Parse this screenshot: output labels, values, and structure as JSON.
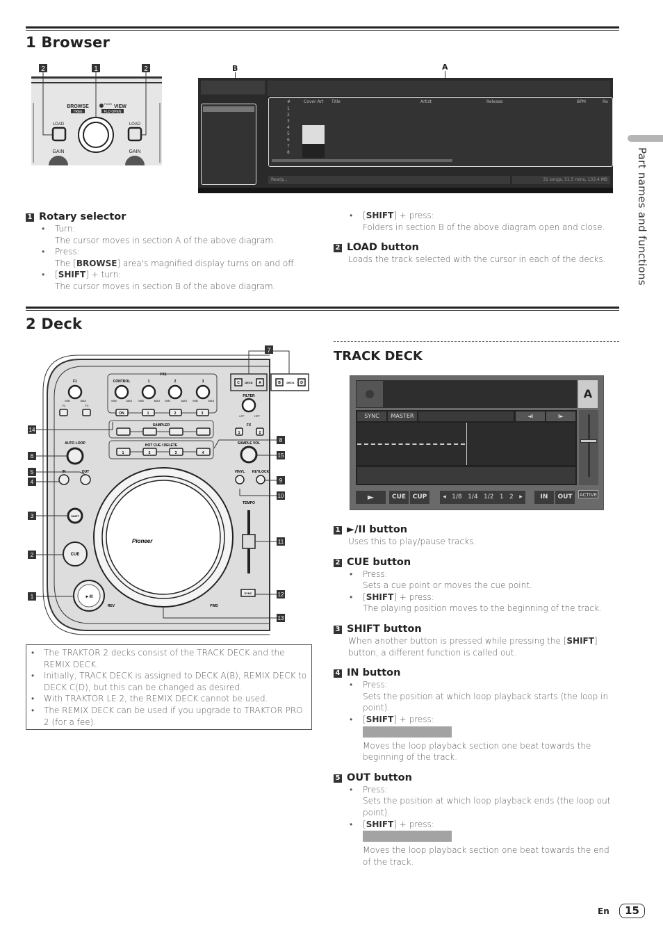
{
  "side_tab": {
    "label": "Part names and functions"
  },
  "browser_section": {
    "title": "1 Browser",
    "controller": {
      "callouts": [
        "2",
        "1",
        "2"
      ],
      "browse": "BROWSE",
      "tree": "TREE",
      "push": "PUSH",
      "view": "VIEW",
      "fld_open": "FLD OPEN",
      "load_left": "LOAD",
      "load_right": "LOAD",
      "gain_left": "GAIN",
      "gain_right": "GAIN"
    },
    "screen_labels": {
      "b": "B",
      "a": "A"
    },
    "screen": {
      "columns": [
        "#",
        "Cover Art",
        "Title",
        "Artist",
        "Release",
        "BPM",
        "Ra"
      ],
      "row_numbers": [
        "1",
        "2",
        "3",
        "4",
        "5",
        "6",
        "7",
        "8"
      ],
      "status_left": "Ready...",
      "status_right": "31 songs, 51.5 mins, 133.4 MB"
    },
    "rotary": {
      "num": "1",
      "title": "Rotary selector",
      "turn": "Turn:",
      "turn_desc": "The cursor moves in section A of the above diagram.",
      "press": "Press:",
      "press_pre": "The [",
      "press_bold": "BROWSE",
      "press_post": "] area's magnified display turns on and off.",
      "shift_pre": "[",
      "shift_bold": "SHIFT",
      "shift_turn_post": "] + turn:",
      "shift_turn_desc": "The cursor moves in section B of the above diagram.",
      "shift_press_post": "] + press:",
      "shift_press_desc": "Folders in section B of the above diagram open and close."
    },
    "load": {
      "num": "2",
      "title": "LOAD button",
      "desc": "Loads the track selected with the cursor in each of the decks."
    }
  },
  "deck_section": {
    "title": "2 Deck",
    "diagram": {
      "fx1": "FX1",
      "f1": "F1",
      "f2": "F2",
      "f3": "F3",
      "control": "CONTROL",
      "k1": "1",
      "k2": "2",
      "k3": "3",
      "min": "MIN",
      "max": "MAX",
      "on": "ON",
      "sampler": "SAMPLER",
      "hot_cue": "HOT CUE / DELETE",
      "auto_loop": "AUTO LOOP",
      "in": "IN",
      "out": "OUT",
      "filter": "FILTER",
      "lpf": "LPF",
      "hpf": "HPF",
      "fx": "FX",
      "sample_vol": "SAMPLE VOL",
      "vinyl": "VINYL",
      "keylock": "KEYLOCK",
      "tempo": "TEMPO",
      "sync": "SYNC",
      "rev": "REV",
      "fwd": "FWD",
      "cue": "CUE",
      "shift": "SHIFT",
      "deck": "DECK",
      "c": "C",
      "a": "A",
      "b": "B",
      "d": "D",
      "play": "►/II",
      "logo": "Pioneer",
      "callouts_left": [
        "14",
        "6",
        "5",
        "4",
        "3",
        "2",
        "1"
      ],
      "callouts_right": [
        "8",
        "15",
        "9",
        "10",
        "11",
        "12",
        "13"
      ],
      "callout_top": "7"
    },
    "notes": [
      "The TRAKTOR 2 decks consist of the TRACK DECK and the REMIX DECK.",
      "Initially, TRACK DECK is assigned to DECK A(B), REMIX DECK to DECK C(D), but this can be changed as desired.",
      "With TRAKTOR LE 2, the REMIX DECK cannot be used.",
      "The REMIX DECK can be used if you upgrade to TRAKTOR PRO 2 (for a fee)."
    ],
    "track_deck": {
      "title": "TRACK DECK",
      "screen": {
        "deck_letter": "A",
        "sync": "SYNC",
        "master": "MASTER",
        "cue": "CUE",
        "cup": "CUP",
        "loop_sizes": [
          "1/8",
          "1/4",
          "1/2",
          "1",
          "2"
        ],
        "in": "IN",
        "out": "OUT",
        "active": "ACTIVE"
      },
      "items": [
        {
          "num": "1",
          "title": "►/II button",
          "desc": "Uses this to play/pause tracks."
        },
        {
          "num": "2",
          "title": "CUE button",
          "press": "Press:",
          "press_desc": "Sets a cue point or moves the cue point.",
          "shift_pre": "[",
          "shift_bold": "SHIFT",
          "shift_post": "] + press:",
          "shift_desc": "The playing position moves to the beginning of the track."
        },
        {
          "num": "3",
          "title": "SHIFT button",
          "desc_pre": "When another button is pressed while pressing the [",
          "desc_bold": "SHIFT",
          "desc_post": "] button, a different function is called out."
        },
        {
          "num": "4",
          "title": "IN button",
          "press": "Press:",
          "press_desc": "Sets the position at which loop playback starts (the loop in point).",
          "shift_pre": "[",
          "shift_bold": "SHIFT",
          "shift_post": "] + press:",
          "shift_desc": "Moves the loop playback section one beat towards the beginning of the track."
        },
        {
          "num": "5",
          "title": "OUT button",
          "press": "Press:",
          "press_desc": "Sets the position at which loop playback ends (the loop out point).",
          "shift_pre": "[",
          "shift_bold": "SHIFT",
          "shift_post": "] + press:",
          "shift_desc": "Moves the loop playback section one beat towards the end of the track."
        }
      ]
    }
  },
  "footer": {
    "lang": "En",
    "page": "15"
  }
}
